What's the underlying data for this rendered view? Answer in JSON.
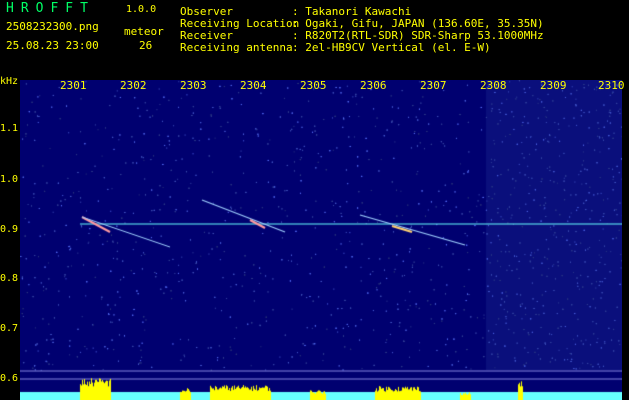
{
  "app": {
    "name": "HROFFT",
    "version": "1.0.0"
  },
  "file": {
    "name": "2508232300.png",
    "datetime": "25.08.23 23:00"
  },
  "meteor": {
    "label": "meteor",
    "count": "26"
  },
  "info": [
    {
      "label": "Observer",
      "value": ": Takanori Kawachi"
    },
    {
      "label": "Receiving Location",
      "value": ": Ogaki, Gifu, JAPAN (136.60E, 35.35N)"
    },
    {
      "label": "Receiver",
      "value": ": R820T2(RTL-SDR) SDR-Sharp 53.1000MHz"
    },
    {
      "label": "Receiving antenna",
      "value": ": 2el-HB9CV Vertical (el. E-W)"
    }
  ],
  "axes": {
    "y_unit": "kHz",
    "x_ticks": [
      "2301",
      "2302",
      "2303",
      "2304",
      "2305",
      "2306",
      "2307",
      "2308",
      "2309",
      "2310"
    ],
    "y_ticks": [
      "1.1",
      "1.0",
      "0.9",
      "0.8",
      "0.7",
      "0.6"
    ]
  },
  "colors": {
    "background": "#00008a",
    "text_yellow": "#ffff00",
    "title_green": "#00ff66",
    "bars": "#ffff00",
    "carrier": "#66ffff"
  }
}
